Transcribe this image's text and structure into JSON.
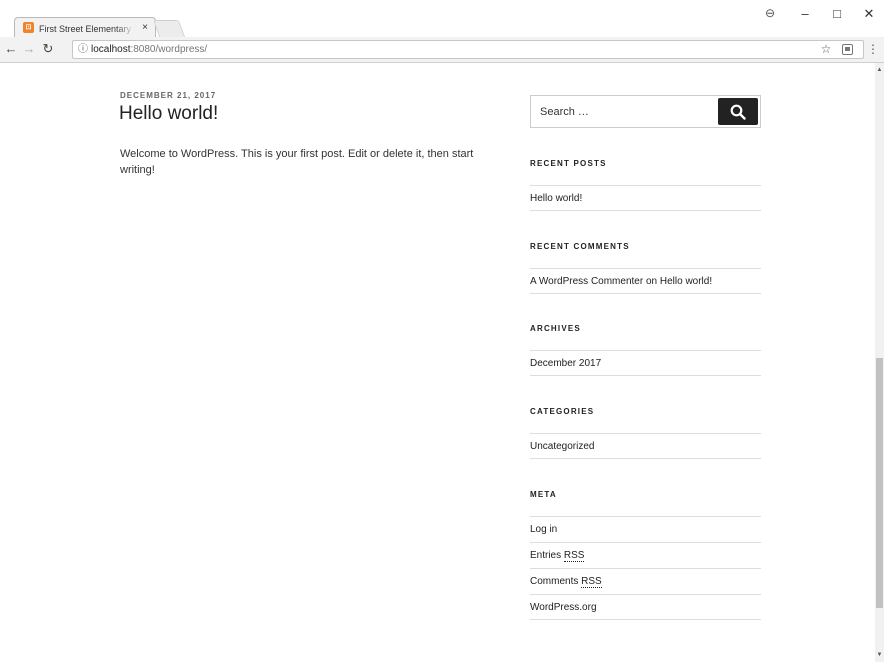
{
  "browser": {
    "tab_title": "First Street Elementary Sc",
    "tab_close": "×",
    "url_host": "localhost",
    "url_rest": ":8080/wordpress/",
    "icons": {
      "back": "arrow-left-icon",
      "forward": "arrow-right-icon",
      "reload": "reload-icon",
      "info": "info-icon",
      "star": "star-icon",
      "extension": "extension-icon",
      "menu": "kebab-menu-icon",
      "account": "account-icon"
    }
  },
  "post": {
    "date": "DECEMBER 21, 2017",
    "title": "Hello world!",
    "body": "Welcome to WordPress. This is your first post. Edit or delete it, then start writing!"
  },
  "sidebar": {
    "search_placeholder": "Search …",
    "recent_posts": {
      "title": "RECENT POSTS",
      "items": [
        "Hello world!"
      ]
    },
    "recent_comments": {
      "title": "RECENT COMMENTS",
      "author": "A WordPress Commenter",
      "on": " on ",
      "post": "Hello world!"
    },
    "archives": {
      "title": "ARCHIVES",
      "items": [
        "December 2017"
      ]
    },
    "categories": {
      "title": "CATEGORIES",
      "items": [
        "Uncategorized"
      ]
    },
    "meta": {
      "title": "META",
      "login": "Log in",
      "entries_prefix": "Entries ",
      "comments_prefix": "Comments ",
      "rss": "RSS",
      "wordpress_org": "WordPress.org"
    }
  },
  "colors": {
    "search_button": "#222222",
    "favicon": "#f0842a",
    "divider": "#dddddd"
  }
}
